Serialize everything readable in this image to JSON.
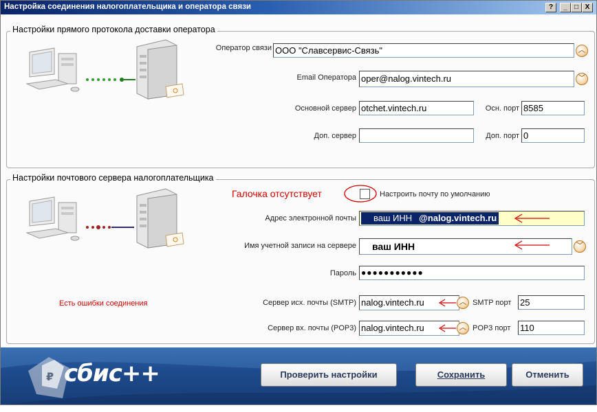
{
  "window": {
    "title": "Настройка соединения налогоплательщика и оператора связи",
    "buttons": {
      "help": "?",
      "minimize": "_",
      "maximize": "□",
      "close": "X"
    }
  },
  "operator_section": {
    "title": "Настройки прямого протокола доставки оператора",
    "operator_label": "Оператор связи",
    "operator_value": "ООО \"Славсервис-Связь\"",
    "email_label": "Email Оператора",
    "email_value": "oper@nalog.vintech.ru",
    "main_server_label": "Основной сервер",
    "main_server_value": "otchet.vintech.ru",
    "main_port_label": "Осн. порт",
    "main_port_value": "8585",
    "extra_server_label": "Доп. сервер",
    "extra_server_value": "",
    "extra_port_label": "Доп. порт",
    "extra_port_value": "0"
  },
  "mail_section": {
    "title": "Настройки почтового сервера налогоплательщика",
    "checkbox_annotation": "Галочка отсутствует",
    "default_mail_label": "Настроить почту по умолчанию",
    "default_mail_checked": false,
    "email_label": "Адрес электронной почты",
    "email_value_part1": "ваш ИНН",
    "email_value_part2": "@nalog.vintech.ru",
    "account_label": "Имя учетной записи на сервере",
    "account_value": "ваш ИНН",
    "password_label": "Пароль",
    "password_value": "●●●●●●●●●●●",
    "error_text": "Есть ошибки соединения",
    "smtp_label": "Сервер исх. почты (SMTP)",
    "smtp_value": "nalog.vintech.ru",
    "smtp_port_label": "SMTP порт",
    "smtp_port_value": "25",
    "pop3_label": "Сервер вх. почты (POP3)",
    "pop3_value": "nalog.vintech.ru",
    "pop3_port_label": "POP3 порт",
    "pop3_port_value": "110"
  },
  "footer": {
    "logo_text": "сбис++",
    "check_button": "Проверить настройки",
    "save_button": "Сохранить",
    "cancel_button": "Отменить"
  },
  "colors": {
    "titlebar": "#0a246a",
    "annotation": "#d00000",
    "email_field_bg": "#ffffc8",
    "selection": "#0a246a",
    "footer": "#1e4b8c"
  }
}
